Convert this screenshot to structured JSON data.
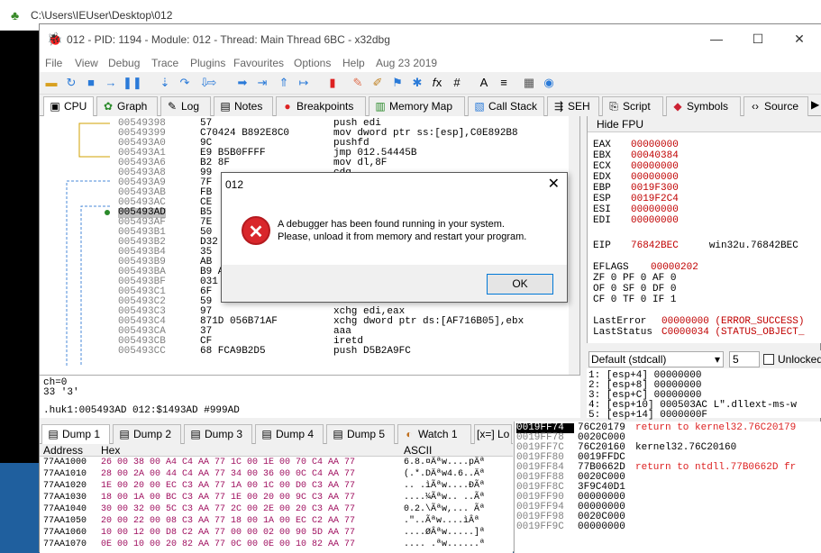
{
  "explorer": {
    "path": "C:\\Users\\IEUser\\Desktop\\012"
  },
  "window": {
    "title": "012 - PID: 1194 - Module: 012 - Thread: Main Thread 6BC - x32dbg",
    "minimize": "—",
    "maximize": "☐",
    "close": "✕"
  },
  "menu": {
    "items": [
      "File",
      "View",
      "Debug",
      "Trace",
      "Plugins",
      "Favourites",
      "Options",
      "Help",
      "Aug 23 2019"
    ]
  },
  "tabs": [
    {
      "label": "CPU",
      "icon": "cpu-icon"
    },
    {
      "label": "Graph",
      "icon": "graph-icon"
    },
    {
      "label": "Log",
      "icon": "log-icon"
    },
    {
      "label": "Notes",
      "icon": "notes-icon"
    },
    {
      "label": "Breakpoints",
      "icon": "breakpoint-icon"
    },
    {
      "label": "Memory Map",
      "icon": "memory-icon"
    },
    {
      "label": "Call Stack",
      "icon": "callstack-icon"
    },
    {
      "label": "SEH",
      "icon": "seh-icon"
    },
    {
      "label": "Script",
      "icon": "script-icon"
    },
    {
      "label": "Symbols",
      "icon": "symbols-icon"
    },
    {
      "label": "Source",
      "icon": "source-icon"
    }
  ],
  "disasm": {
    "rows": [
      {
        "addr": "00549398",
        "bytes": "57",
        "instr": "push edi"
      },
      {
        "addr": "00549399",
        "bytes": "C70424 B892E8C0",
        "instr": "mov dword ptr ss:[esp],C0E892B8"
      },
      {
        "addr": "005493A0",
        "bytes": "9C",
        "instr": "pushfd"
      },
      {
        "addr": "005493A1",
        "bytes": "E9 B5B0FFFF",
        "instr": "jmp 012.54445B"
      },
      {
        "addr": "005493A6",
        "bytes": "B2 8F",
        "instr": "mov dl,8F"
      },
      {
        "addr": "005493A8",
        "bytes": "99",
        "instr": "cdq"
      },
      {
        "addr": "005493A9",
        "bytes": "7F",
        "instr": ""
      },
      {
        "addr": "005493AB",
        "bytes": "FB",
        "instr": ""
      },
      {
        "addr": "005493AC",
        "bytes": "CE",
        "instr": ""
      },
      {
        "addr": "005493AD",
        "bytes": "B5",
        "instr": ""
      },
      {
        "addr": "005493AF",
        "bytes": "7E",
        "instr": ""
      },
      {
        "addr": "005493B1",
        "bytes": "50",
        "instr": ""
      },
      {
        "addr": "005493B2",
        "bytes": "D32",
        "instr": ""
      },
      {
        "addr": "005493B4",
        "bytes": "35",
        "instr": ""
      },
      {
        "addr": "005493B9",
        "bytes": "AB",
        "instr": ""
      },
      {
        "addr": "005493BA",
        "bytes": "B9 A",
        "instr": ""
      },
      {
        "addr": "005493BF",
        "bytes": "031",
        "instr": ""
      },
      {
        "addr": "005493C1",
        "bytes": "6F",
        "instr": ""
      },
      {
        "addr": "005493C2",
        "bytes": "59",
        "instr": ""
      },
      {
        "addr": "005493C3",
        "bytes": "97",
        "instr": "xchg edi,eax"
      },
      {
        "addr": "005493C4",
        "bytes": "871D 056B71AF",
        "instr": "xchg dword ptr ds:[AF716B05],ebx"
      },
      {
        "addr": "005493CA",
        "bytes": "37",
        "instr": "aaa"
      },
      {
        "addr": "005493CB",
        "bytes": "CF",
        "instr": "iretd"
      },
      {
        "addr": "005493CC",
        "bytes": "68 FCA9B2D5",
        "instr": "push D5B2A9FC"
      }
    ]
  },
  "info": {
    "line1": "ch=0",
    "line2": "33 '3'",
    "line3": ".huk1:005493AD 012:$1493AD #999AD"
  },
  "registers": {
    "header": "Hide FPU",
    "general": [
      {
        "name": "EAX",
        "value": "00000000"
      },
      {
        "name": "EBX",
        "value": "00040384"
      },
      {
        "name": "ECX",
        "value": "00000000"
      },
      {
        "name": "EDX",
        "value": "00000000"
      },
      {
        "name": "EBP",
        "value": "0019F300"
      },
      {
        "name": "ESP",
        "value": "0019F2C4"
      },
      {
        "name": "ESI",
        "value": "00000000"
      },
      {
        "name": "EDI",
        "value": "00000000"
      }
    ],
    "eip": {
      "name": "EIP",
      "value": "76842BEC",
      "label": "win32u.76842BEC"
    },
    "eflags": {
      "name": "EFLAGS",
      "value": "00000202"
    },
    "flags": [
      "ZF 0  PF 0  AF 0",
      "OF 0  SF 0  DF 0",
      "CF 0  TF 0  IF 1"
    ],
    "lasterror": {
      "name": "LastError",
      "value": "00000000 (ERROR_SUCCESS)"
    },
    "laststatus": {
      "name": "LastStatus",
      "value": "C0000034 (STATUS_OBJECT_"
    }
  },
  "callconv": {
    "selected": "Default (stdcall)",
    "count": "5",
    "unlocked": "Unlocked"
  },
  "stackargs": [
    "1: [esp+4] 00000000",
    "2: [esp+8] 00000000",
    "3: [esp+C] 00000000",
    "4: [esp+10] 000503AC L\".dllext-ms-w",
    "5: [esp+14] 0000000F"
  ],
  "dumptabs": [
    "Dump 1",
    "Dump 2",
    "Dump 3",
    "Dump 4",
    "Dump 5",
    "Watch 1",
    "[x=] Lo"
  ],
  "dump": {
    "headers": {
      "address": "Address",
      "hex": "Hex",
      "ascii": "ASCII"
    },
    "rows": [
      {
        "addr": "77AA1000",
        "hex": "26 00 38 00  A4 C4 AA 77  1C 00 1E 00  70 C4 AA 77",
        "ascii": "6.8.¤Äªw....pÄª"
      },
      {
        "addr": "77AA1010",
        "hex": "28 00 2A 00  44 C4 AA 77  34 00 36 00  0C C4 AA 77",
        "ascii": "(.*.DÄªw4.6..Äª"
      },
      {
        "addr": "77AA1020",
        "hex": "1E 00 20 00  EC C3 AA 77  1A 00 1C 00  D0 C3 AA 77",
        "ascii": ".. .ìÃªw....ÐÃª"
      },
      {
        "addr": "77AA1030",
        "hex": "18 00 1A 00  BC C3 AA 77  1E 00 20 00  9C C3 AA 77",
        "ascii": "....¼Ãªw.. ..Ãª"
      },
      {
        "addr": "77AA1040",
        "hex": "30 00 32 00  5C C3 AA 77  2C 00 2E 00  20 C3 AA 77",
        "ascii": "0.2.\\Ãªw,... Ãª"
      },
      {
        "addr": "77AA1050",
        "hex": "20 00 22 00  08 C3 AA 77  18 00 1A 00  EC C2 AA 77",
        "ascii": " .\"..Ãªw....ìÂª"
      },
      {
        "addr": "77AA1060",
        "hex": "10 00 12 00  D8 C2 AA 77  00 00 02 00  90 5D AA 77",
        "ascii": "....ØÂªw.....]ª"
      },
      {
        "addr": "77AA1070",
        "hex": "0E 00 10 00  20 82 AA 77  0C 00 0E 00  10 82 AA 77",
        "ascii": ".... .ªw......ª"
      }
    ]
  },
  "stack": {
    "rows": [
      {
        "addr": "0019FF74",
        "value": "76C20179",
        "comment": "return to kernel32.76C20179"
      },
      {
        "addr": "0019FF78",
        "value": "0020C000",
        "comment": ""
      },
      {
        "addr": "0019FF7C",
        "value": "76C20160",
        "comment": "kernel32.76C20160"
      },
      {
        "addr": "0019FF80",
        "value": "0019FFDC",
        "comment": ""
      },
      {
        "addr": "0019FF84",
        "value": "77B0662D",
        "comment": "return to ntdll.77B0662D fr"
      },
      {
        "addr": "0019FF88",
        "value": "0020C000",
        "comment": ""
      },
      {
        "addr": "0019FF8C",
        "value": "3F9C40D1",
        "comment": ""
      },
      {
        "addr": "0019FF90",
        "value": "00000000",
        "comment": ""
      },
      {
        "addr": "0019FF94",
        "value": "00000000",
        "comment": ""
      },
      {
        "addr": "0019FF98",
        "value": "0020C000",
        "comment": ""
      },
      {
        "addr": "0019FF9C",
        "value": "00000000",
        "comment": ""
      }
    ]
  },
  "dialog": {
    "title": "012",
    "close": "✕",
    "icon": "error-icon",
    "message_line1": "A debugger has been found running in your system.",
    "message_line2": "Please, unload it from memory and restart your program.",
    "ok": "OK"
  },
  "colors": {
    "accent": "#0078d7",
    "register_value": "#c00000",
    "error_red": "#d9262b",
    "selection": "#c0c0c0"
  }
}
